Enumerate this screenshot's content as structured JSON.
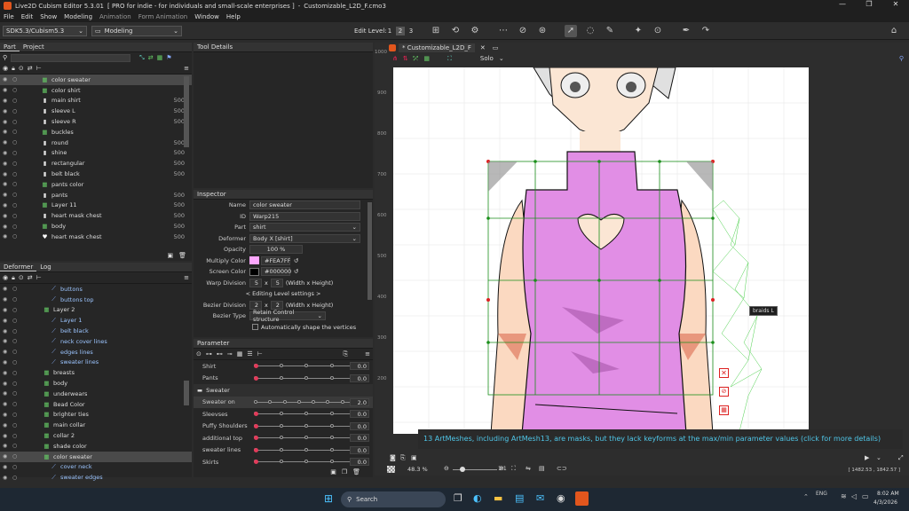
{
  "window": {
    "app_name": "Live2D Cubism Editor 5.3.01",
    "license": "[ PRO for indie - for individuals and small-scale enterprises ]",
    "file": "Customizable_L2D_F.cmo3",
    "title_sep": "-"
  },
  "menu": [
    "File",
    "Edit",
    "Show",
    "Modeling",
    "Animation",
    "Form Animation",
    "Window",
    "Help"
  ],
  "toolbar": {
    "sdk": "SDK5.3/Cubism5.3",
    "mode": "Modeling",
    "edit_level_label": "Edit Level:",
    "levels": [
      "1",
      "2",
      "3"
    ]
  },
  "part_panel": {
    "tabs": [
      "Part",
      "Project"
    ],
    "items": [
      {
        "name": "color sweater",
        "icon": "grid",
        "num": ""
      },
      {
        "name": "color shirt",
        "icon": "grid",
        "num": ""
      },
      {
        "name": "main shirt",
        "icon": "mesh",
        "num": "500"
      },
      {
        "name": "sleeve L",
        "icon": "mesh",
        "num": "500"
      },
      {
        "name": "sleeve R",
        "icon": "mesh",
        "num": "500"
      },
      {
        "name": "buckles",
        "icon": "grid",
        "num": ""
      },
      {
        "name": "round",
        "icon": "mesh",
        "num": "500"
      },
      {
        "name": "shine",
        "icon": "mesh",
        "num": "500"
      },
      {
        "name": "rectangular",
        "icon": "mesh",
        "num": "500"
      },
      {
        "name": "belt black",
        "icon": "mesh",
        "num": "500"
      },
      {
        "name": "pants color",
        "icon": "grid",
        "num": ""
      },
      {
        "name": "pants",
        "icon": "mesh",
        "num": "500"
      },
      {
        "name": "Layer 11",
        "icon": "grid",
        "num": "500"
      },
      {
        "name": "heart mask chest",
        "icon": "mesh",
        "num": "500"
      },
      {
        "name": "body",
        "icon": "grid",
        "num": "500"
      },
      {
        "name": "heart mask chest",
        "icon": "heart",
        "num": "500"
      }
    ]
  },
  "deformer_panel": {
    "tabs": [
      "Deformer",
      "Log"
    ],
    "items": [
      {
        "name": "buttons",
        "indent": 2
      },
      {
        "name": "buttons top",
        "indent": 2
      },
      {
        "name": "Layer 2",
        "indent": 1
      },
      {
        "name": "Layer 1",
        "indent": 2
      },
      {
        "name": "belt black",
        "indent": 2
      },
      {
        "name": "neck cover lines",
        "indent": 2
      },
      {
        "name": "edges lines",
        "indent": 2
      },
      {
        "name": "sweater lines",
        "indent": 2
      },
      {
        "name": "breasts",
        "indent": 1
      },
      {
        "name": "body",
        "indent": 1
      },
      {
        "name": "underwears",
        "indent": 1
      },
      {
        "name": "Bead Color",
        "indent": 1
      },
      {
        "name": "brighter ties",
        "indent": 1
      },
      {
        "name": "main collar",
        "indent": 1
      },
      {
        "name": "collar 2",
        "indent": 1
      },
      {
        "name": "shade color",
        "indent": 1
      },
      {
        "name": "color sweater",
        "indent": 1
      },
      {
        "name": "cover neck",
        "indent": 2
      },
      {
        "name": "sweater edges",
        "indent": 2
      }
    ]
  },
  "tool_details": {
    "title": "Tool Details"
  },
  "inspector": {
    "title": "Inspector",
    "name_label": "Name",
    "name": "color sweater",
    "id_label": "ID",
    "id": "Warp215",
    "part_label": "Part",
    "part": "shirt",
    "deformer_label": "Deformer",
    "deformer": "Body X [shirt]",
    "opacity_label": "Opacity",
    "opacity": "100 %",
    "multiply_label": "Multiply Color",
    "multiply": "#FEA7FF",
    "screen_label": "Screen Color",
    "screen": "#000000",
    "warp_div_label": "Warp Division",
    "warp_w": "5",
    "warp_h": "5",
    "warp_hint": "(Width x Height)",
    "editing_level": "< Editing Level settings >",
    "bezier_div_label": "Bezier Division",
    "bezier_w": "2",
    "bezier_h": "2",
    "bezier_hint": "(Width x Height)",
    "bezier_type_label": "Bezier Type",
    "bezier_type": "Retain Control structure",
    "auto_shape": "Automatically shape the vertices",
    "x": "x"
  },
  "parameter": {
    "title": "Parameter",
    "rows": [
      {
        "label": "Shirt",
        "value": "0.0",
        "type": "param"
      },
      {
        "label": "Pants",
        "value": "0.0",
        "type": "param"
      },
      {
        "label": "Sweater",
        "value": "",
        "type": "group"
      },
      {
        "label": "Sweater on",
        "value": "2.0",
        "type": "param"
      },
      {
        "label": "Sleevses",
        "value": "0.0",
        "type": "param"
      },
      {
        "label": "Puffy Shoulders",
        "value": "0.0",
        "type": "param"
      },
      {
        "label": "additional top",
        "value": "0.0",
        "type": "param"
      },
      {
        "label": "sweater lines",
        "value": "0.0",
        "type": "param"
      },
      {
        "label": "Skirts",
        "value": "0.0",
        "type": "param"
      }
    ]
  },
  "viewport": {
    "tab": "* Customizable_L2D_F",
    "solo": "Solo",
    "ruler": [
      "1000",
      "900",
      "800",
      "700",
      "600",
      "500",
      "400",
      "300",
      "200"
    ],
    "tooltip": "braids L",
    "warning": "13 ArtMeshes, including ArtMesh13, are masks, but they lack keyforms at the max/min parameter values (click for more details)",
    "zoom": "48.3 %",
    "ratio": "1:1",
    "coords": "[ 1482.53 , 1842.57 ]"
  },
  "taskbar": {
    "search": "Search",
    "lang": "ENG",
    "time": "8:02 AM",
    "date": "4/3/2026"
  },
  "colors": {
    "sweater": "#e18ee5",
    "accent": "#e2561d",
    "warning_bg": "#2a2a2a",
    "warning_text": "#4fc6e8"
  }
}
